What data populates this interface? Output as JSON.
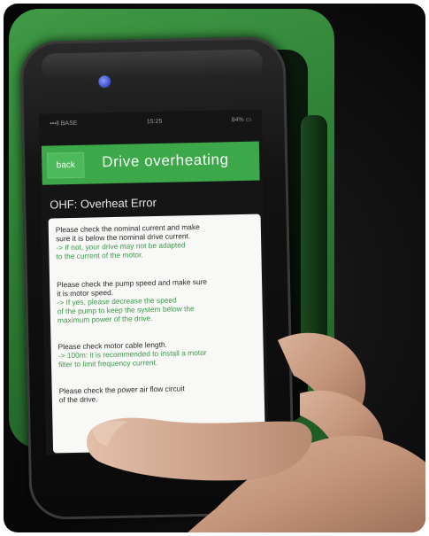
{
  "status_bar": {
    "carrier": "•••ll BASE",
    "time": "15:25",
    "battery": "84% ▭"
  },
  "header": {
    "back_label": "back",
    "title": "Drive overheating"
  },
  "error": {
    "code_line": "OHF: Overheat Error"
  },
  "checks": [
    {
      "text_1": "Please check the nominal current and make",
      "text_2": "sure it is below the nominal drive current.",
      "advice_1": "-> If not, your drive may not be adapted",
      "advice_2": "to the current of the motor.",
      "advice_3": ""
    },
    {
      "text_1": "Please check the pump speed and make sure",
      "text_2": "it is motor speed.",
      "advice_1": "-> If yes, please decrease the speed",
      "advice_2": "of the pump to keep the system below the",
      "advice_3": "maximum power of the drive."
    },
    {
      "text_1": "Please check motor cable length.",
      "text_2": "",
      "advice_1": "-> 100m: it is recommended to install a motor",
      "advice_2": "filter to limit frequency current.",
      "advice_3": ""
    },
    {
      "text_1": "Please check the power air flow circuit",
      "text_2": "of the drive.",
      "advice_1": "",
      "advice_2": "",
      "advice_3": ""
    }
  ],
  "colors": {
    "header_green": "#3da84a",
    "advice_green": "#3b9a4b",
    "drive_green": "#2f7e36"
  }
}
